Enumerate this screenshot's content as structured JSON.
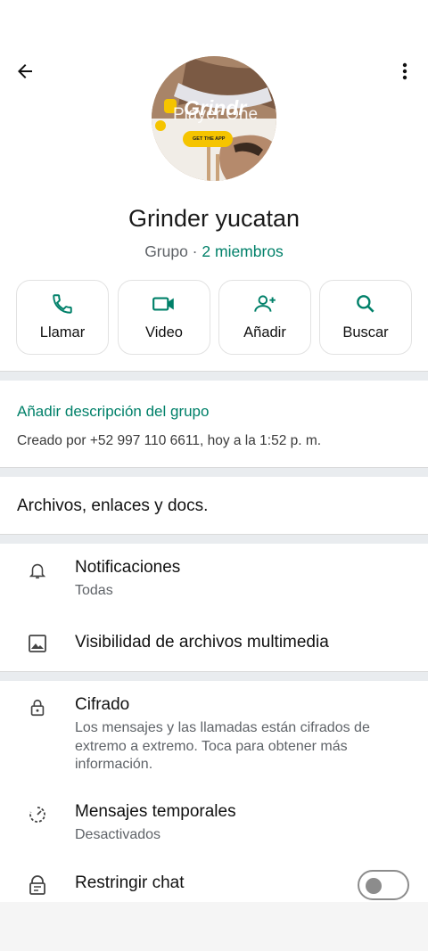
{
  "group": {
    "name": "Grinder yucatan",
    "type_label": "Grupo · ",
    "members_label": "2 miembros"
  },
  "avatar": {
    "logo_text": "Grindr",
    "overlay_text": "Player One",
    "button_text": "GET THE APP"
  },
  "actions": [
    {
      "label": "Llamar",
      "icon": "phone-icon"
    },
    {
      "label": "Video",
      "icon": "video-icon"
    },
    {
      "label": "Añadir",
      "icon": "add-person-icon"
    },
    {
      "label": "Buscar",
      "icon": "search-icon"
    }
  ],
  "description": {
    "add_label": "Añadir descripción del grupo",
    "created_text": "Creado por +52 997 110 6611, hoy a la 1:52 p. m."
  },
  "files_label": "Archivos, enlaces y docs.",
  "settings": {
    "notifications": {
      "title": "Notificaciones",
      "sub": "Todas"
    },
    "media_visibility": {
      "title": "Visibilidad de archivos multimedia"
    },
    "encryption": {
      "title": "Cifrado",
      "sub": "Los mensajes y las llamadas están cifrados de extremo a extremo. Toca para obtener más información."
    },
    "disappearing": {
      "title": "Mensajes temporales",
      "sub": "Desactivados"
    },
    "restrict": {
      "title": "Restringir chat",
      "enabled": false
    }
  },
  "colors": {
    "accent": "#008069",
    "text": "#111111",
    "muted": "#5f6368",
    "divider": "#e9ecef"
  }
}
